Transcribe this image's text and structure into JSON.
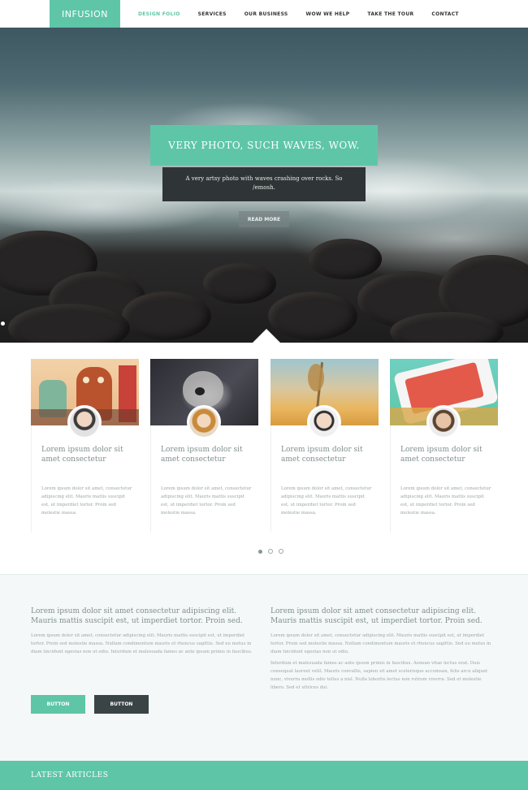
{
  "nav": {
    "logo": "INFUSION",
    "items": [
      {
        "label": "DESIGN FOLIO",
        "active": true
      },
      {
        "label": "SERVICES",
        "active": false
      },
      {
        "label": "OUR BUSINESS",
        "active": false
      },
      {
        "label": "WOW WE HELP",
        "active": false
      },
      {
        "label": "TAKE THE TOUR",
        "active": false
      },
      {
        "label": "CONTACT",
        "active": false
      }
    ]
  },
  "hero": {
    "title": "VERY PHOTO, SUCH WAVES, WOW.",
    "subtitle": "A very artsy photo with waves crashing over rocks. So /emosh.",
    "button": "READ MORE"
  },
  "cards": [
    {
      "title": "Lorem ipsum dolor sit amet consectetur",
      "text": "Lorem ipsum dolor sit amet, consectetur adipiscing elit. Mauris mattis suscipit est, ut imperdiet tortor. Proin sed molestie massa.",
      "image_icon": "bear-illustration-image",
      "avatar_icon": "man-avatar-icon"
    },
    {
      "title": "Lorem ipsum dolor sit amet consectetur",
      "text": "Lorem ipsum dolor sit amet, consectetur adipiscing elit. Mauris mattis suscipit est, ut imperdiet tortor. Proin sed molestie massa.",
      "image_icon": "dog-photo-image",
      "avatar_icon": "woman-avatar-icon"
    },
    {
      "title": "Lorem ipsum dolor sit amet consectetur",
      "text": "Lorem ipsum dolor sit amet, consectetur adipiscing elit. Mauris mattis suscipit est, ut imperdiet tortor. Proin sed molestie massa.",
      "image_icon": "wheat-photo-image",
      "avatar_icon": "glasses-man-avatar-icon"
    },
    {
      "title": "Lorem ipsum dolor sit amet consectetur",
      "text": "Lorem ipsum dolor sit amet, consectetur adipiscing elit. Mauris mattis suscipit est, ut imperdiet tortor. Proin sed molestie massa.",
      "image_icon": "phone-app-image",
      "avatar_icon": "smiling-man-avatar-icon"
    }
  ],
  "slider_dots": 3,
  "info": {
    "left": {
      "title": "Lorem ipsum dolor sit amet consectetur adipiscing elit. Mauris mattis suscipit est, ut imperdiet tortor. Proin sed.",
      "text": "Lorem ipsum dolor sit amet, consectetur adipiscing elit. Mauris mattis suscipit est, ut imperdiet tortor. Proin sed molestie massa. Nullam condimentum mauris et rhoncus sagittis. Sed eu metus in diam tincidunt egestas non ut odio. Interdum et malesuada fames ac ante ipsum primis in faucibus."
    },
    "right": {
      "title": "Lorem ipsum dolor sit amet consectetur adipiscing elit. Mauris mattis suscipit est, ut imperdiet tortor. Proin sed.",
      "text": "Lorem ipsum dolor sit amet, consectetur adipiscing elit. Mauris mattis suscipit est, ut imperdiet tortor. Proin sed molestie massa. Nullam condimentum mauris et rhoncus sagittis. Sed eu metus in diam tincidunt egestas non ut odio.",
      "text2": "Interdum et malesuada fames ac ante ipsum primis in faucibus. Aenean vitae lectus erat. Duis consequat laoreet velit. Mauris convallis, sapien sit amet scelerisque accumsan, felis arcu aliquet nunc, viverra mollis odio tellus a nisl. Nulla lobortis lectus non rutrum viverra. Sed et molestie libero. Sed et ultrices dui."
    },
    "button_primary": "BUTTON",
    "button_secondary": "BUTTON"
  },
  "footer": {
    "latest_label": "LATEST ARTICLES"
  },
  "colors": {
    "accent": "#5ec6a7",
    "dark": "#3a4346"
  }
}
